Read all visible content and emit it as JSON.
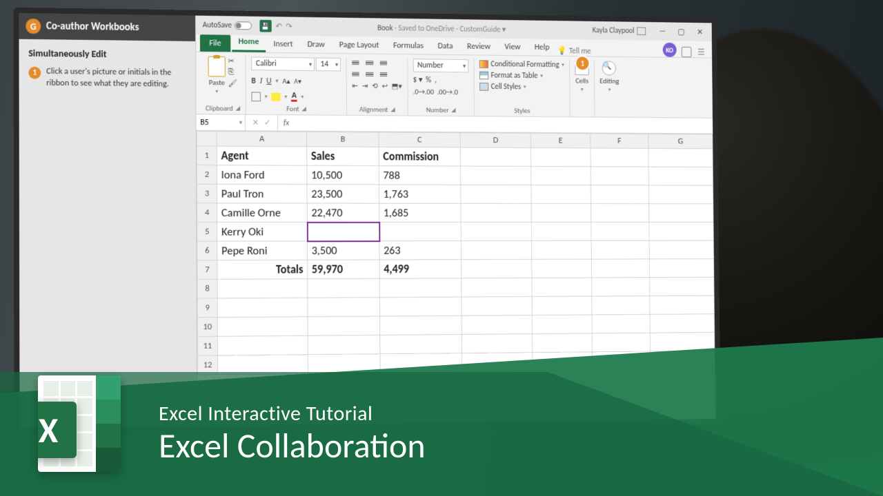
{
  "tutorial": {
    "header": "Co-author Workbooks",
    "section": "Simultaneously Edit",
    "step_num": "1",
    "step_text": "Click a user's picture or initials in the ribbon to see what they are editing."
  },
  "titlebar": {
    "autosave": "AutoSave",
    "autosave_state": "Off",
    "doc_name": "Book",
    "doc_status": "Saved to OneDrive - CustomGuide",
    "user": "Kayla Claypool"
  },
  "tabs": {
    "file": "File",
    "home": "Home",
    "insert": "Insert",
    "draw": "Draw",
    "page_layout": "Page Layout",
    "formulas": "Formulas",
    "data": "Data",
    "review": "Review",
    "view": "View",
    "help": "Help",
    "tellme": "Tell me"
  },
  "avatar_initials": "KO",
  "ribbon": {
    "clipboard": {
      "paste": "Paste",
      "label": "Clipboard"
    },
    "font": {
      "name": "Calibri",
      "size": "14",
      "label": "Font"
    },
    "alignment": {
      "label": "Alignment"
    },
    "number": {
      "format": "Number",
      "label": "Number"
    },
    "styles": {
      "cf": "Conditional Formatting",
      "fat": "Format as Table",
      "cs": "Cell Styles",
      "label": "Styles"
    },
    "cells": {
      "label": "Cells"
    },
    "editing": {
      "label": "Editing"
    },
    "callout": "1"
  },
  "formula": {
    "namebox": "B5",
    "fx": "fx",
    "value": ""
  },
  "columns": [
    "A",
    "B",
    "C",
    "D",
    "E",
    "F",
    "G"
  ],
  "headers": {
    "a": "Agent",
    "b": "Sales",
    "c": "Commission"
  },
  "rows": [
    {
      "n": "1"
    },
    {
      "n": "2",
      "a": "Iona Ford",
      "b": "10,500",
      "c": "788"
    },
    {
      "n": "3",
      "a": "Paul Tron",
      "b": "23,500",
      "c": "1,763"
    },
    {
      "n": "4",
      "a": "Camille Orne",
      "b": "22,470",
      "c": "1,685"
    },
    {
      "n": "5",
      "a": "Kerry Oki",
      "b": "",
      "c": ""
    },
    {
      "n": "6",
      "a": "Pepe Roni",
      "b": "3,500",
      "c": "263"
    },
    {
      "n": "7",
      "a": "Totals",
      "b": "59,970",
      "c": "4,499"
    },
    {
      "n": "8"
    },
    {
      "n": "9"
    },
    {
      "n": "10"
    },
    {
      "n": "11"
    },
    {
      "n": "12"
    }
  ],
  "overlay": {
    "subtitle": "Excel Interactive Tutorial",
    "title": "Excel Collaboration",
    "logo_letter": "X"
  }
}
